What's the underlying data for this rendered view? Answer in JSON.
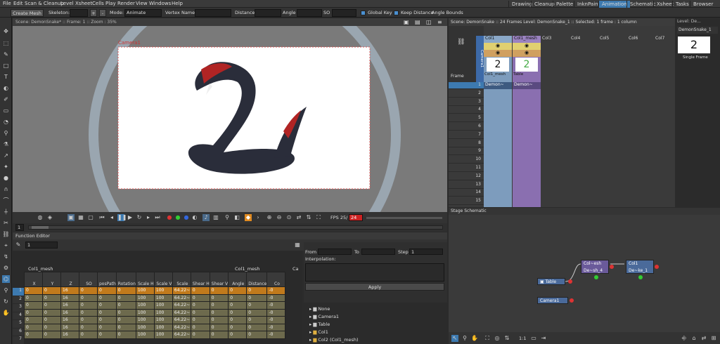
{
  "menu": [
    "File",
    "Edit",
    "Scan & Cleanup",
    "Level",
    "Xsheet",
    "Cells",
    "Play",
    "Render",
    "View",
    "Windows",
    "Help"
  ],
  "rooms": [
    "Drawing",
    "Cleanup",
    "Palette",
    "InknPaint",
    "Animation",
    "Schematic",
    "Xsheet",
    "Tasks",
    "Browser"
  ],
  "active_room": "Animation",
  "tool_options": {
    "create_mesh": "Create Mesh",
    "skeleton_label": "Skeleton:",
    "mode_label": "Mode:",
    "mode_value": "Animate",
    "vertex_name_label": "Vertex Name:",
    "distance_label": "Distance",
    "angle_label": "Angle",
    "so_label": "SO",
    "global_key": "Global Key",
    "keep_distance": "Keep Distance",
    "angle_bounds": "Angle Bounds"
  },
  "viewer": {
    "title": "Scene: DemonSnake*  ::  Frame: 1  ::  Zoom : 35%",
    "camera_label": "Camera1",
    "fps_label": "FPS 25/",
    "fps_value": "24",
    "frame_value": "1"
  },
  "function_editor": {
    "title": "Function Editor",
    "frame_field": "1",
    "group_label": "Col1_mesh",
    "group_label2": "Col1_mesh",
    "group_label3": "Ca",
    "columns": [
      "X",
      "Y",
      "Z",
      "SO",
      "posPath",
      "Rotation",
      "Scale H",
      "Scale V",
      "Scale",
      "Shear H",
      "Shear V",
      "Angle",
      "Distance",
      "Co"
    ],
    "rows": [
      [
        "0",
        "0",
        "16",
        "0",
        "0",
        "0",
        "100",
        "100",
        "64.22~",
        "0",
        "0",
        "0",
        "0",
        "-0"
      ],
      [
        "0",
        "0",
        "16",
        "0",
        "0",
        "0",
        "100",
        "100",
        "64.22~",
        "0",
        "0",
        "0",
        "0",
        "-0"
      ],
      [
        "0",
        "0",
        "16",
        "0",
        "0",
        "0",
        "100",
        "100",
        "64.22~",
        "0",
        "0",
        "0",
        "0",
        "-0"
      ],
      [
        "0",
        "0",
        "16",
        "0",
        "0",
        "0",
        "100",
        "100",
        "64.22~",
        "0",
        "0",
        "0",
        "0",
        "-0"
      ],
      [
        "0",
        "0",
        "16",
        "0",
        "0",
        "0",
        "100",
        "100",
        "64.22~",
        "0",
        "0",
        "0",
        "0",
        "-0"
      ],
      [
        "0",
        "0",
        "16",
        "0",
        "0",
        "0",
        "100",
        "100",
        "64.22~",
        "0",
        "0",
        "0",
        "0",
        "-0"
      ],
      [
        "0",
        "0",
        "16",
        "0",
        "0",
        "0",
        "100",
        "100",
        "64.22~",
        "0",
        "0",
        "0",
        "0",
        "-0"
      ]
    ],
    "row_numbers": [
      "1",
      "2",
      "3",
      "4",
      "5",
      "6",
      "7"
    ],
    "from_label": "From",
    "to_label": "To",
    "step_label": "Step",
    "step_value": "1",
    "interpolation_label": "Interpolation:",
    "apply_label": "Apply",
    "tree": [
      "None",
      "Camera1",
      "Table",
      "Col1",
      "Col2 (Col1_mesh)"
    ]
  },
  "xsheet": {
    "title": "Scene: DemonSnake  ::  24 Frames  Level: DemonSnake_1  ::  Selected: 1 frame : 1 column",
    "columns": [
      "Col1",
      "Col1_mesh",
      "Col3",
      "Col4",
      "Col5",
      "Col6",
      "Col7"
    ],
    "level_names": [
      "Col1_mesh",
      "Table"
    ],
    "camera_col": "Camera1",
    "frame_label": "Frame",
    "cell_names": [
      "Demon~",
      "Demon~"
    ],
    "frames": [
      "1",
      "2",
      "3",
      "4",
      "5",
      "6",
      "7",
      "8",
      "9",
      "10",
      "11",
      "12",
      "13",
      "14",
      "15"
    ]
  },
  "level_strip": {
    "title": "Level: De...",
    "level_name": "DemonSnake_1",
    "frame_label": "Single Frame"
  },
  "stage": {
    "title": "Stage Schematic",
    "nodes": {
      "table": "Table",
      "camera": "Camera1",
      "mesh_top": "Col~esh",
      "mesh_bottom": "De~sh_4",
      "col1_top": "Col1",
      "col1_bottom": "De~ke_1"
    },
    "zoom_label": "1:1"
  }
}
